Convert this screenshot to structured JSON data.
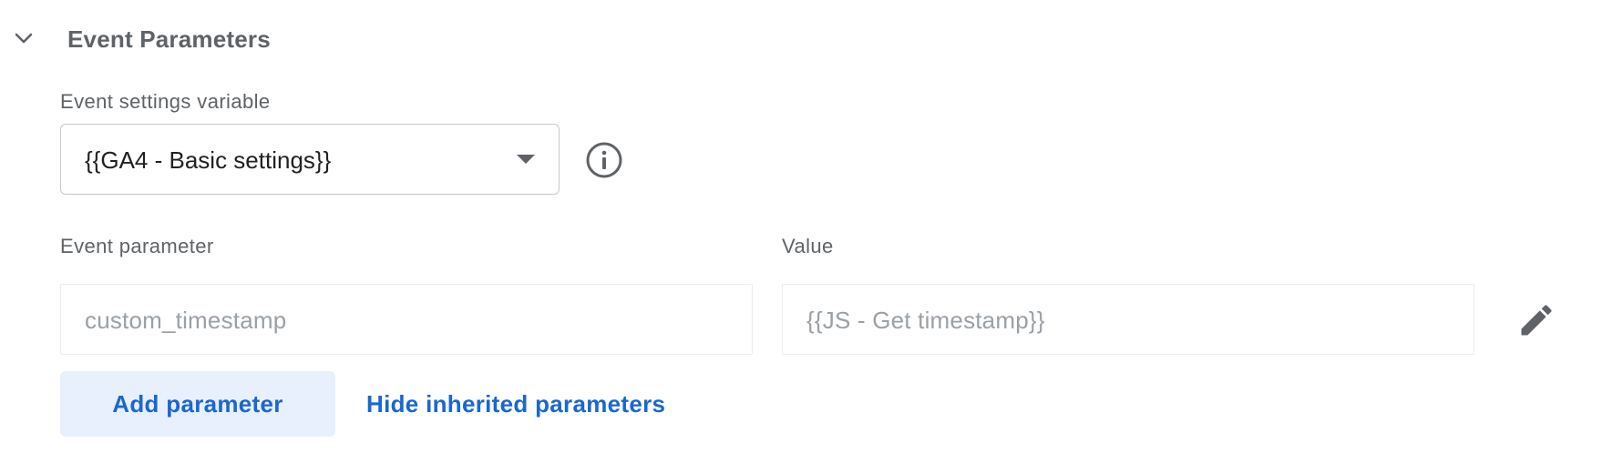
{
  "section": {
    "title": "Event Parameters",
    "chevron_icon": "chevron-down-icon"
  },
  "event_settings": {
    "label": "Event settings variable",
    "selected_value": "{{GA4 - Basic settings}}",
    "dropdown_icon": "dropdown-arrow-icon",
    "info_icon": "info-icon"
  },
  "parameters": {
    "param_header": "Event parameter",
    "value_header": "Value",
    "rows": [
      {
        "parameter": "custom_timestamp",
        "value": "{{JS - Get timestamp}}",
        "edit_icon": "pencil-icon"
      }
    ]
  },
  "actions": {
    "add_parameter": "Add parameter",
    "hide_inherited": "Hide inherited parameters"
  },
  "colors": {
    "accent": "#1967d2",
    "button_bg": "#e8f0fe",
    "muted_text": "#5f6368",
    "placeholder_text": "#9aa0a6"
  }
}
